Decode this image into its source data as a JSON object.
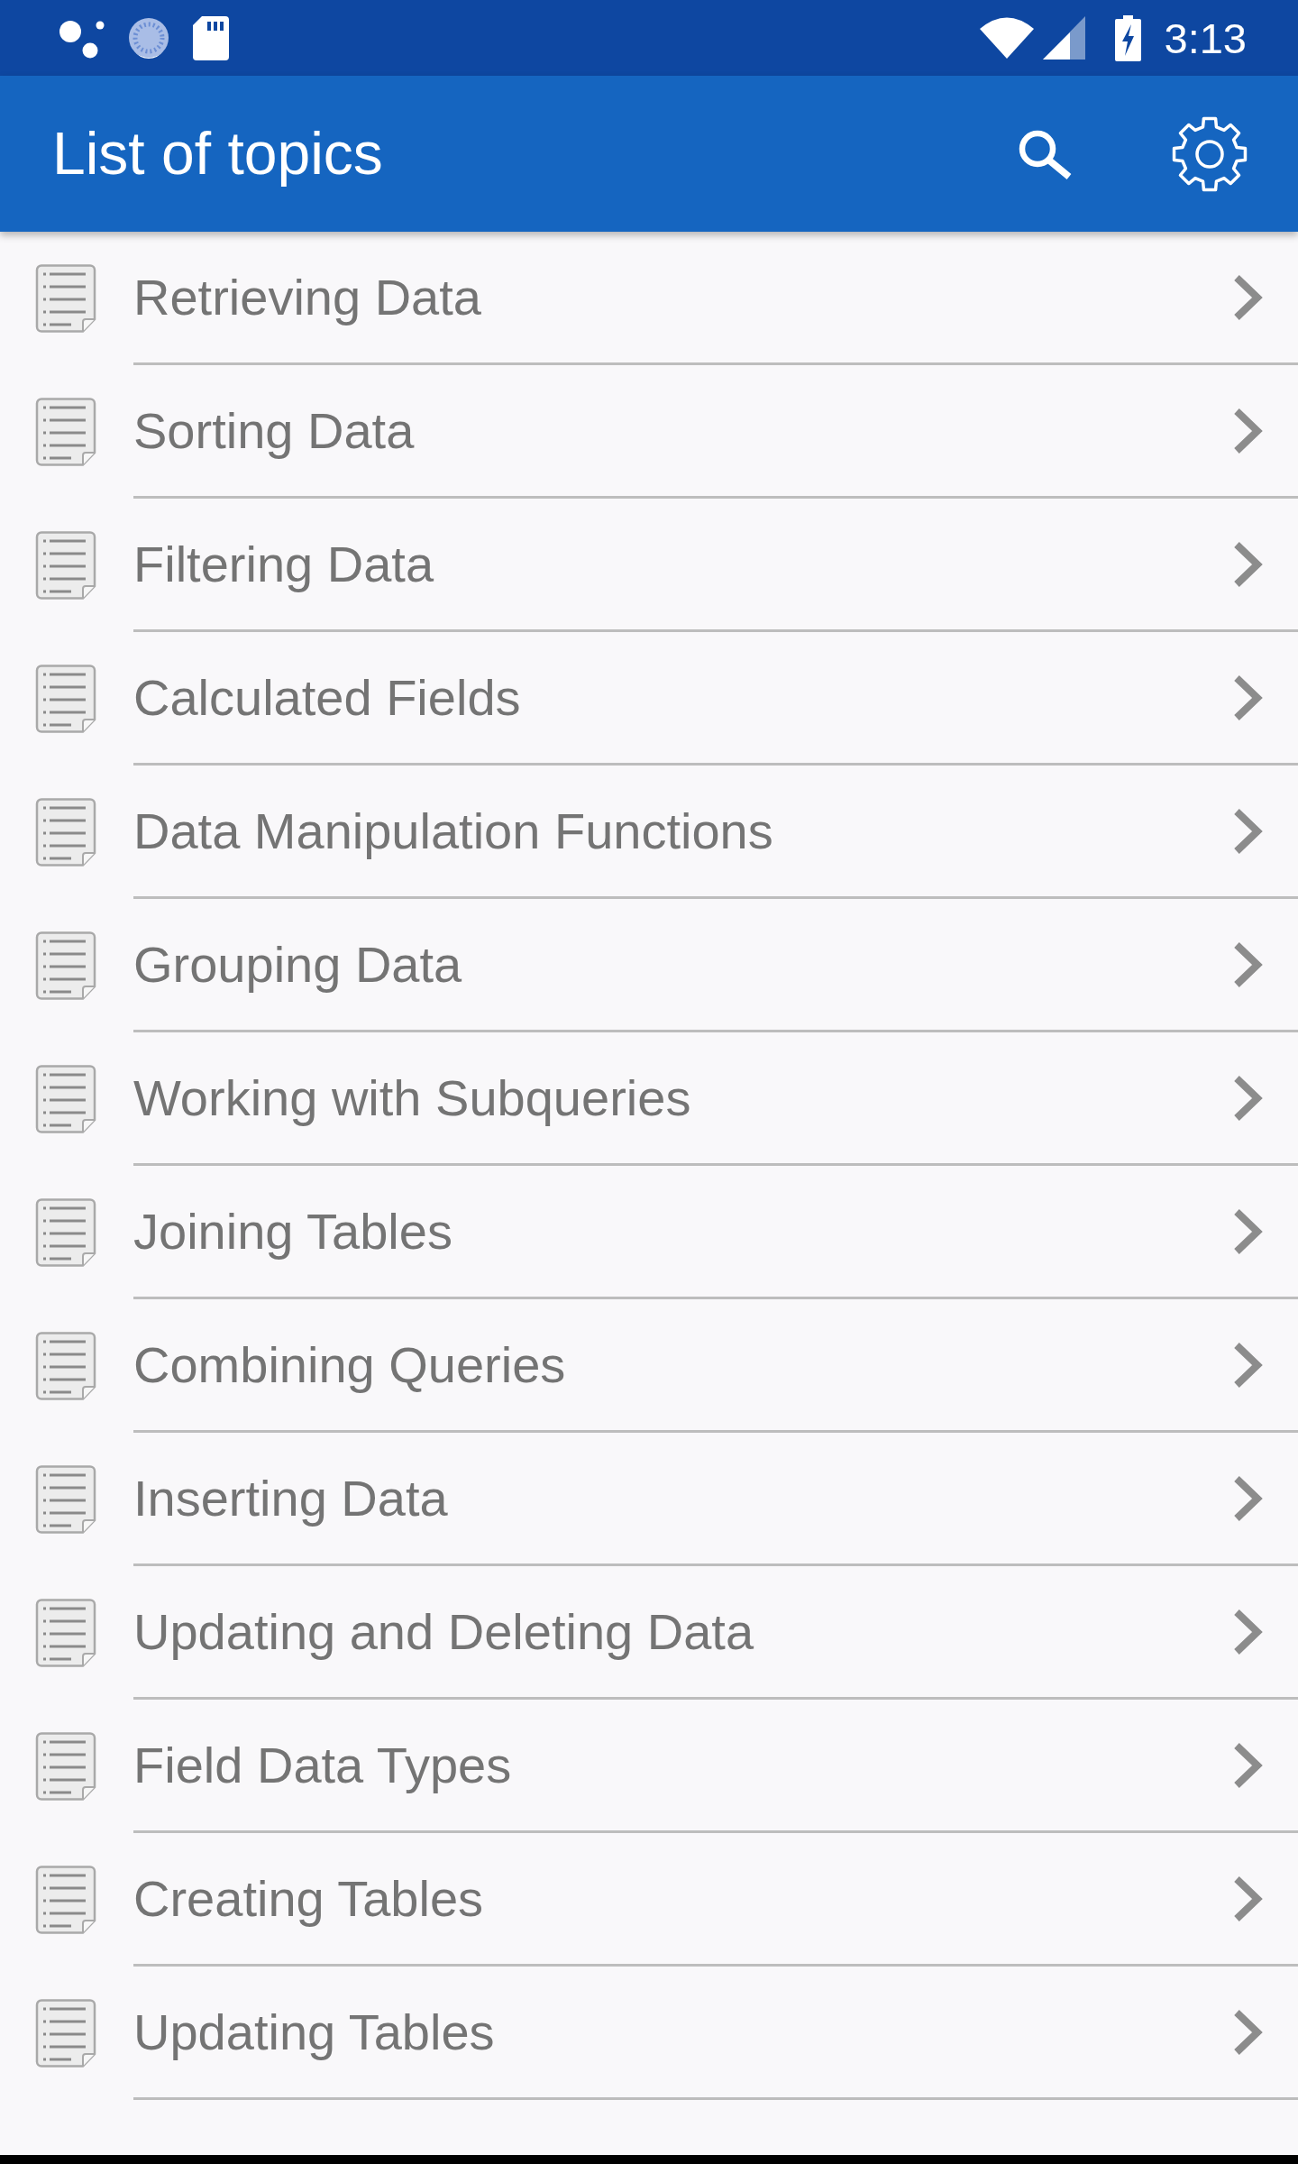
{
  "status_bar": {
    "time": "3:13"
  },
  "app_bar": {
    "title": "List of topics"
  },
  "topics": [
    "Retrieving Data",
    "Sorting Data",
    "Filtering Data",
    "Calculated Fields",
    "Data Manipulation Functions",
    "Grouping Data",
    "Working with Subqueries",
    "Joining Tables",
    "Combining Queries",
    "Inserting Data",
    "Updating and Deleting Data",
    "Field Data Types",
    "Creating Tables",
    "Updating Tables"
  ]
}
